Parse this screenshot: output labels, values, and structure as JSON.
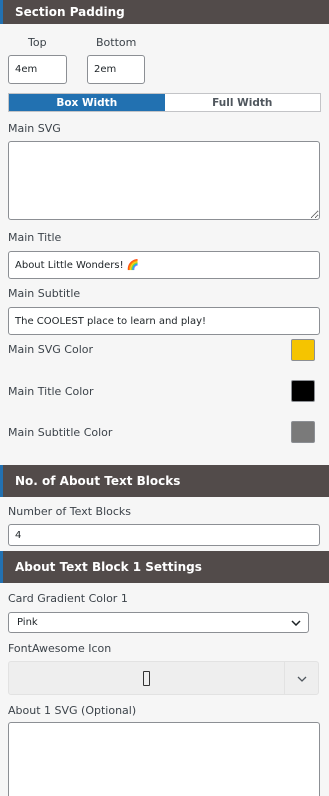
{
  "section_padding": {
    "header": "Section Padding",
    "top_label": "Top",
    "top_value": "4em",
    "bottom_label": "Bottom",
    "bottom_value": "2em"
  },
  "width_toggle": {
    "options": [
      "Box Width",
      "Full Width"
    ],
    "selected": "Box Width"
  },
  "main_svg": {
    "label": "Main SVG",
    "value": ""
  },
  "main_title": {
    "label": "Main Title",
    "value": "About Little Wonders! 🌈"
  },
  "main_subtitle": {
    "label": "Main Subtitle",
    "value": "The COOLEST place to learn and play!"
  },
  "colors": {
    "svg": {
      "label": "Main SVG Color",
      "value": "#f5c400"
    },
    "title": {
      "label": "Main Title Color",
      "value": "#000000"
    },
    "subtitle": {
      "label": "Main Subtitle Color",
      "value": "#7a7a7a"
    }
  },
  "about_blocks": {
    "header": "No. of About Text Blocks",
    "count_label": "Number of Text Blocks",
    "count_value": "4"
  },
  "block1": {
    "header": "About Text Block 1 Settings",
    "gradient_label": "Card Gradient Color 1",
    "gradient_value": "Pink",
    "icon_label": "FontAwesome Icon",
    "icon_name": "empty-glyph-icon",
    "svg_label": "About 1 SVG (Optional)",
    "svg_value": ""
  },
  "theme": {
    "header_bg": "#524b4a",
    "accent": "#2271b1"
  }
}
